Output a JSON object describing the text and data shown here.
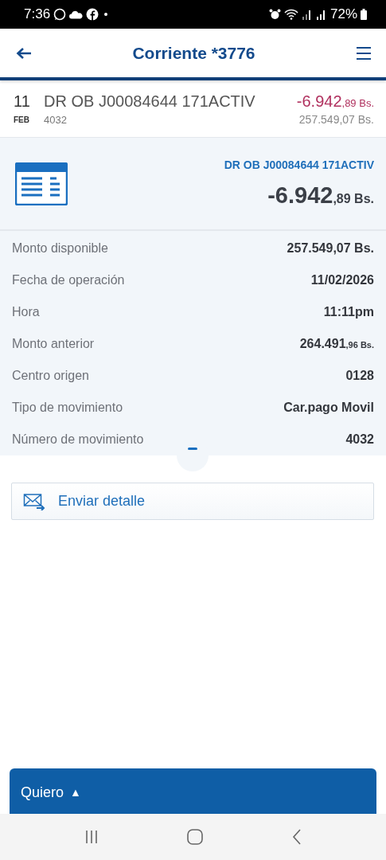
{
  "status_bar": {
    "time": "7:36",
    "battery": "72%"
  },
  "header": {
    "title": "Corriente *3776"
  },
  "transaction": {
    "day": "11",
    "month": "FEB",
    "description": "DR OB J00084644 171ACTIV",
    "reference": "4032",
    "amount_main": "-6.942",
    "amount_small": ",89 Bs.",
    "balance": "257.549,07 Bs."
  },
  "detail_card": {
    "description": "DR OB J00084644 171ACTIV",
    "amount_main": "-6.942",
    "amount_small": ",89 Bs."
  },
  "details": [
    {
      "label": "Monto disponible",
      "value": "257.549,07 Bs."
    },
    {
      "label": "Fecha de operación",
      "value": "11/02/2026"
    },
    {
      "label": "Hora",
      "value": "11:11pm"
    },
    {
      "label": "Monto anterior",
      "value": "264.491",
      "value_small": ",96 Bs."
    },
    {
      "label": "Centro origen",
      "value": "0128"
    },
    {
      "label": "Tipo de movimiento",
      "value": "Car.pago Movil"
    },
    {
      "label": "Número de movimiento",
      "value": "4032"
    }
  ],
  "actions": [
    {
      "label": "Enviar detalle"
    }
  ],
  "bottom_panel": {
    "label": "Quiero",
    "arrow": "▲",
    "expanded": false
  }
}
